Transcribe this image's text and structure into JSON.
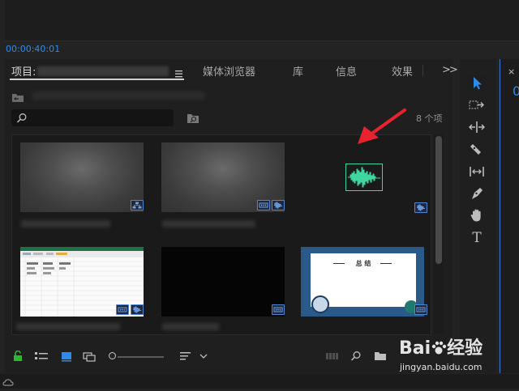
{
  "timecode": "00:00:40:01",
  "tabs": {
    "project": "项目:",
    "media_browser": "媒体浏览器",
    "library": "库",
    "info": "信息",
    "effects": "效果",
    "overflow": ">>"
  },
  "item_count": "8 个项",
  "colors": {
    "accent_blue": "#2d8ceb",
    "badge_blue": "#4f86d6",
    "audio_green": "#3fd6a0",
    "annotation_red": "#e8232f",
    "lock_green": "#2eb82e"
  },
  "tools": [
    "selection-tool",
    "track-select-tool",
    "ripple-edit-tool",
    "razor-tool",
    "slip-tool",
    "pen-tool",
    "hand-tool",
    "type-tool"
  ],
  "tool_type_label": "T",
  "thumbnail_title_text": "总 结",
  "watermark": {
    "brand": "Bai",
    "brand_suffix": "经验",
    "url": "jingyan.baidu.com"
  }
}
